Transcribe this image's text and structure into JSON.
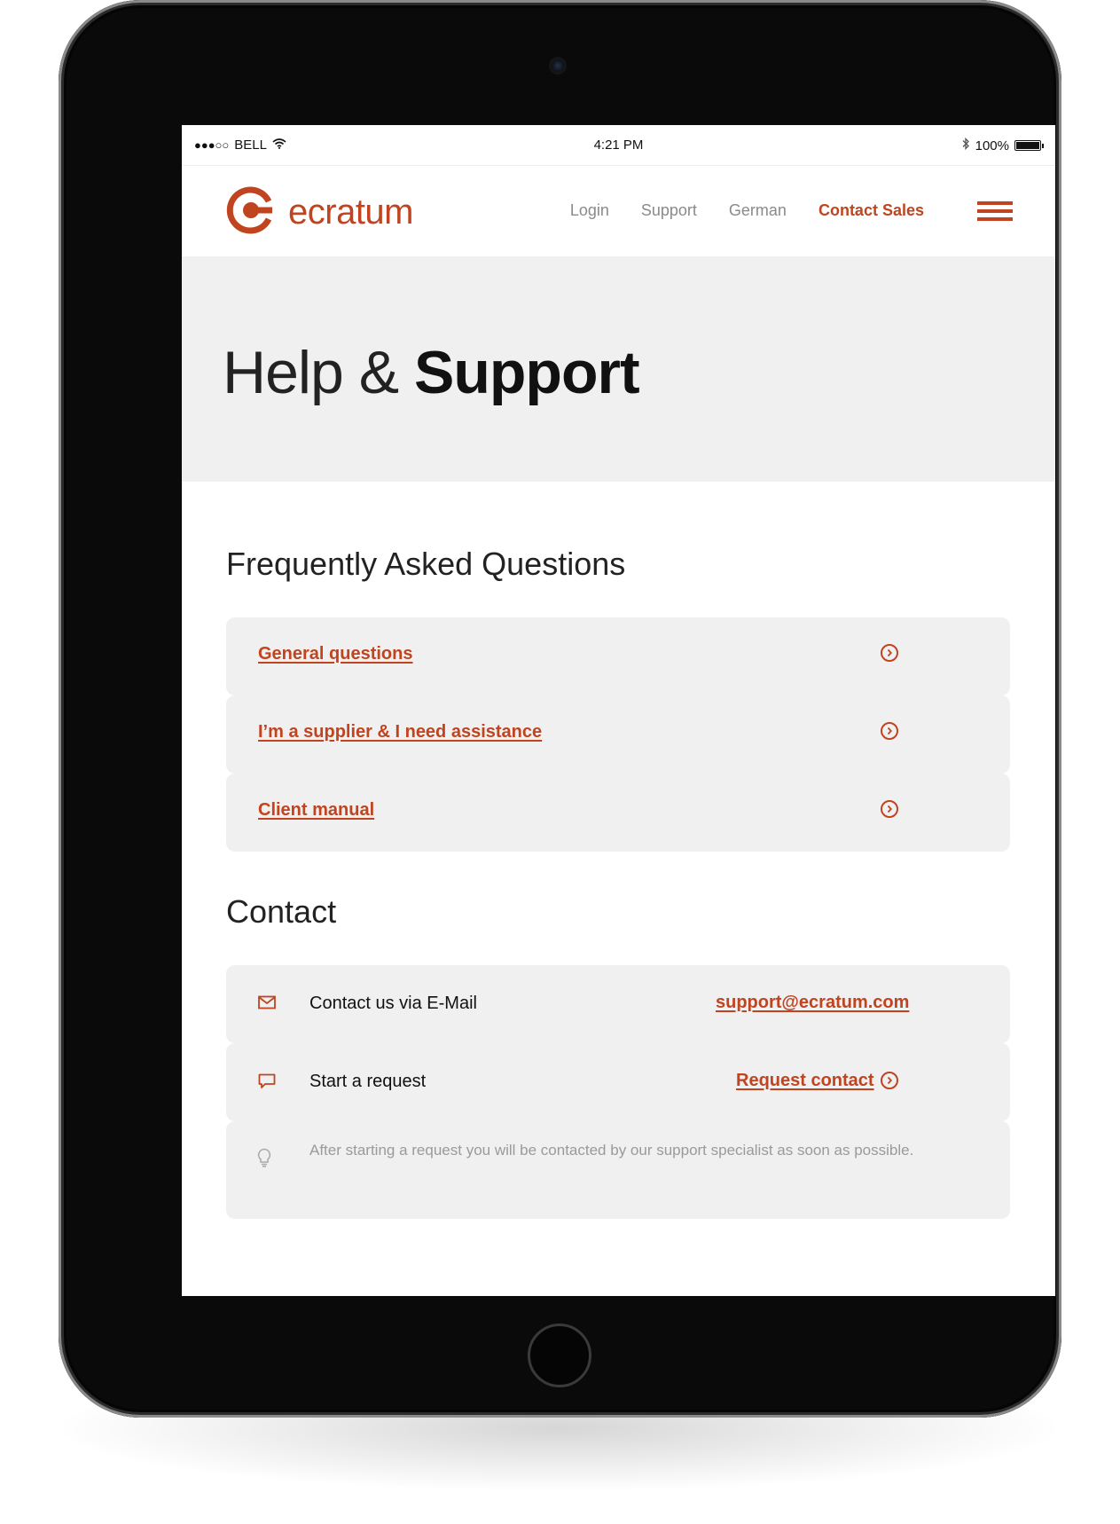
{
  "status_bar": {
    "carrier": "BELL",
    "signal": "●●●○○",
    "time": "4:21 PM",
    "battery": "100%",
    "battery_level": 1.0
  },
  "header": {
    "brand": "ecratum",
    "nav": [
      "Login",
      "Support",
      "German",
      "Contact Sales"
    ],
    "active_nav": "Contact Sales",
    "menu_icon": "hamburger-icon"
  },
  "hero": {
    "title_light": "Help & ",
    "title_bold": "Support"
  },
  "faq": {
    "heading": "Frequently Asked Questions",
    "items": [
      "General questions",
      "I’m a supplier & I need assistance",
      "Client manual"
    ]
  },
  "contact": {
    "heading": "Contact",
    "email_label": "Contact us via E-Mail",
    "email_link": "support@ecratum.com",
    "request_label": "Start a request",
    "request_link": "Request contact",
    "note": "After starting a request you will be contacted by our support specialist as soon as possible."
  },
  "colors": {
    "accent": "#c0441f",
    "panel": "#f0f0f0",
    "muted_text": "#8a8a8a"
  }
}
